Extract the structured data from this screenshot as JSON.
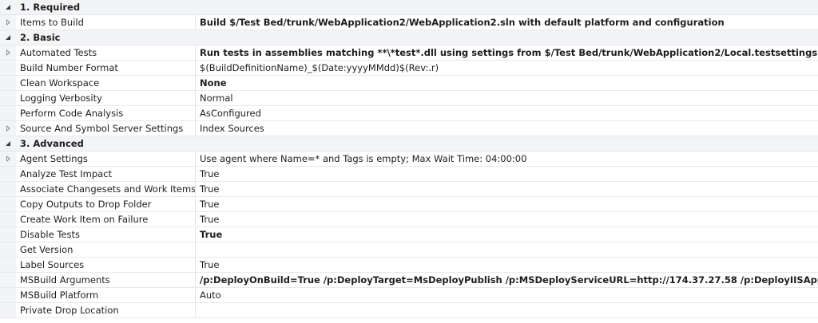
{
  "categories": [
    {
      "title": "1. Required",
      "properties": [
        {
          "name": "Items to Build",
          "value": "Build $/Test Bed/trunk/WebApplication2/WebApplication2.sln with default platform and configuration",
          "bold": true,
          "expandable": true
        }
      ]
    },
    {
      "title": "2. Basic",
      "properties": [
        {
          "name": "Automated Tests",
          "value": "Run tests in assemblies matching **\\*test*.dll using settings from $/Test Bed/trunk/WebApplication2/Local.testsettings",
          "bold": true,
          "expandable": true
        },
        {
          "name": "Build Number Format",
          "value": "$(BuildDefinitionName)_$(Date:yyyyMMdd)$(Rev:.r)",
          "bold": false,
          "expandable": false
        },
        {
          "name": "Clean Workspace",
          "value": "None",
          "bold": true,
          "expandable": false
        },
        {
          "name": "Logging Verbosity",
          "value": "Normal",
          "bold": false,
          "expandable": false
        },
        {
          "name": "Perform Code Analysis",
          "value": "AsConfigured",
          "bold": false,
          "expandable": false
        },
        {
          "name": "Source And Symbol Server Settings",
          "value": "Index Sources",
          "bold": false,
          "expandable": true
        }
      ]
    },
    {
      "title": "3. Advanced",
      "properties": [
        {
          "name": "Agent Settings",
          "value": "Use agent where Name=* and Tags is empty; Max Wait Time: 04:00:00",
          "bold": false,
          "expandable": true
        },
        {
          "name": "Analyze Test Impact",
          "value": "True",
          "bold": false,
          "expandable": false
        },
        {
          "name": "Associate Changesets and Work Items",
          "value": "True",
          "bold": false,
          "expandable": false
        },
        {
          "name": "Copy Outputs to Drop Folder",
          "value": "True",
          "bold": false,
          "expandable": false
        },
        {
          "name": "Create Work Item on Failure",
          "value": "True",
          "bold": false,
          "expandable": false
        },
        {
          "name": "Disable Tests",
          "value": "True",
          "bold": true,
          "expandable": false
        },
        {
          "name": "Get Version",
          "value": "",
          "bold": false,
          "expandable": false
        },
        {
          "name": "Label Sources",
          "value": "True",
          "bold": false,
          "expandable": false
        },
        {
          "name": "MSBuild Arguments",
          "value": "/p:DeployOnBuild=True /p:DeployTarget=MsDeployPublish /p:MSDeployServiceURL=http://174.37.27.58 /p:DeployIISAppPath=\"TestDeplo",
          "bold": true,
          "expandable": false
        },
        {
          "name": "MSBuild Platform",
          "value": "Auto",
          "bold": false,
          "expandable": false
        },
        {
          "name": "Private Drop Location",
          "value": "",
          "bold": false,
          "expandable": false
        }
      ]
    }
  ]
}
